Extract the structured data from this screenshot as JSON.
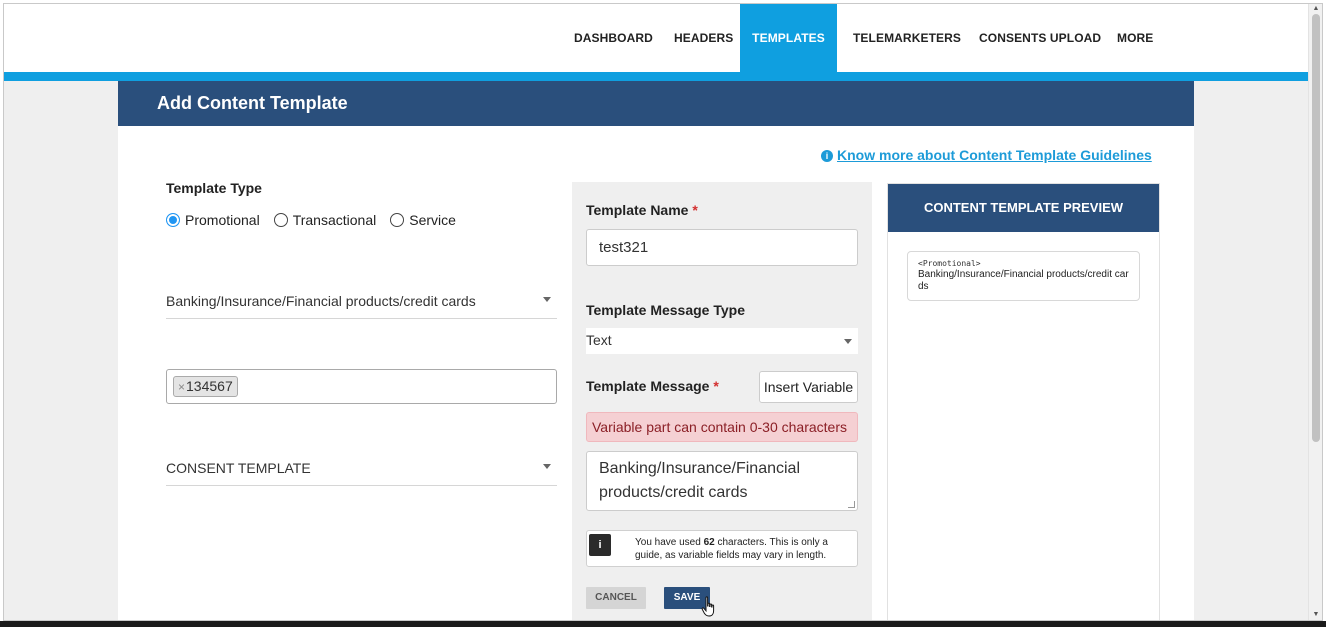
{
  "nav": {
    "items": [
      "DASHBOARD",
      "HEADERS",
      "TEMPLATES",
      "TELEMARKETERS",
      "CONSENTS UPLOAD",
      "MORE"
    ],
    "active": "TEMPLATES"
  },
  "card": {
    "title": "Add Content Template",
    "guidelines_link": "Know more about Content Template Guidelines"
  },
  "form": {
    "template_type_label": "Template Type",
    "template_type_options": [
      "Promotional",
      "Transactional",
      "Service"
    ],
    "template_type_selected": "Promotional",
    "category_value": "Banking/Insurance/Financial products/credit cards",
    "header_tag": "134567",
    "consent_value": "CONSENT TEMPLATE",
    "template_name_label": "Template Name",
    "template_name_value": "test321",
    "message_type_label": "Template Message Type",
    "message_type_value": "Text",
    "message_label": "Template Message",
    "required_mark": "*",
    "insert_variable_label": "Insert Variable",
    "variable_alert": "Variable part can contain 0-30 characters",
    "message_line1": "Banking/Insurance/Financial",
    "message_line2": "products/credit cards",
    "char_note_prefix": "You have used ",
    "char_count": "62",
    "char_note_suffix": " characters. This is only a guide, as variable fields may vary in length.",
    "cancel_label": "CANCEL",
    "save_label": "SAVE"
  },
  "preview": {
    "title": "CONTENT TEMPLATE PREVIEW",
    "tag": "<Promotional>",
    "message": "Banking/Insurance/Financial products/credit cards"
  },
  "colors": {
    "nav_accent": "#0f9fe0",
    "header_navy": "#2a4f7c",
    "link_blue": "#1d9bd8",
    "alert_bg": "#f5d0d3",
    "required_red": "#d32f2f"
  },
  "icons": {
    "info": "info-circle-icon",
    "info_square": "info-square-icon",
    "caret": "caret-down-icon",
    "remove": "remove-tag-icon",
    "cursor": "hand-pointer-icon"
  }
}
